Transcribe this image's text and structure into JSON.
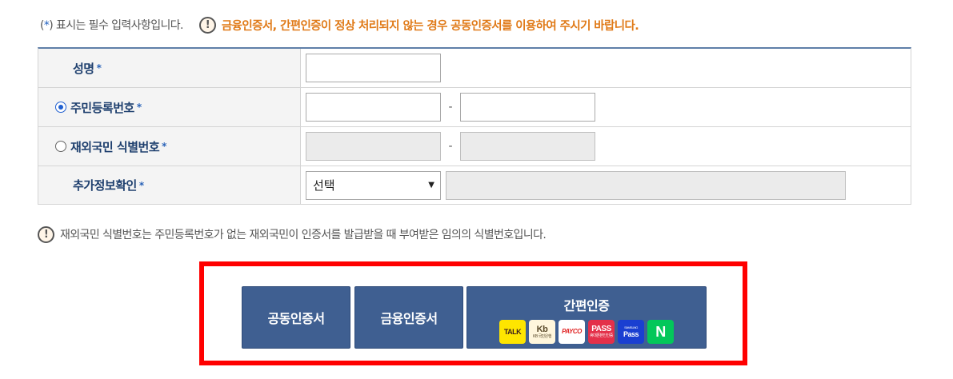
{
  "notice_top": {
    "req_prefix": "(",
    "req_star": "*",
    "req_suffix": ") 표시는 필수 입력사항입니다.",
    "warn_icon": "!",
    "warn_text": "금융인증서, 간편인증이 정상 처리되지 않는 경우 공동인증서를 이용하여 주시기 바랍니다."
  },
  "form": {
    "required_mark": "*",
    "name_label": "성명",
    "rrn_label": "주민등록번호",
    "rrn_selected": true,
    "foreigner_label": "재외국민 식별번호",
    "foreigner_selected": false,
    "extra_label": "추가정보확인",
    "separator": "-",
    "select_value": "선택",
    "select_arrow": "▼"
  },
  "notice_bottom": {
    "icon": "!",
    "text": "재외국민 식별번호는 주민등록번호가 없는 재외국민이 인증서를 발급받을 때 부여받은 임의의 식별번호입니다."
  },
  "buttons": {
    "public_cert": "공동인증서",
    "finance_cert": "금융인증서",
    "simple_auth": "간편인증"
  },
  "providers": {
    "kakao": "TALK",
    "kb": "Kb",
    "kb_sub": "KB 국민은행",
    "payco": "PAYCO",
    "pass": "PASS",
    "pass_sub": "휴대폰본인인증",
    "samsung_sub": "SAMSUNG",
    "samsung": "Pass",
    "naver": "N"
  },
  "colors": {
    "accent_border": "#ff0000",
    "button_bg": "#3f5f91",
    "warning_text": "#e07a18",
    "label_text": "#1e3f6e"
  }
}
